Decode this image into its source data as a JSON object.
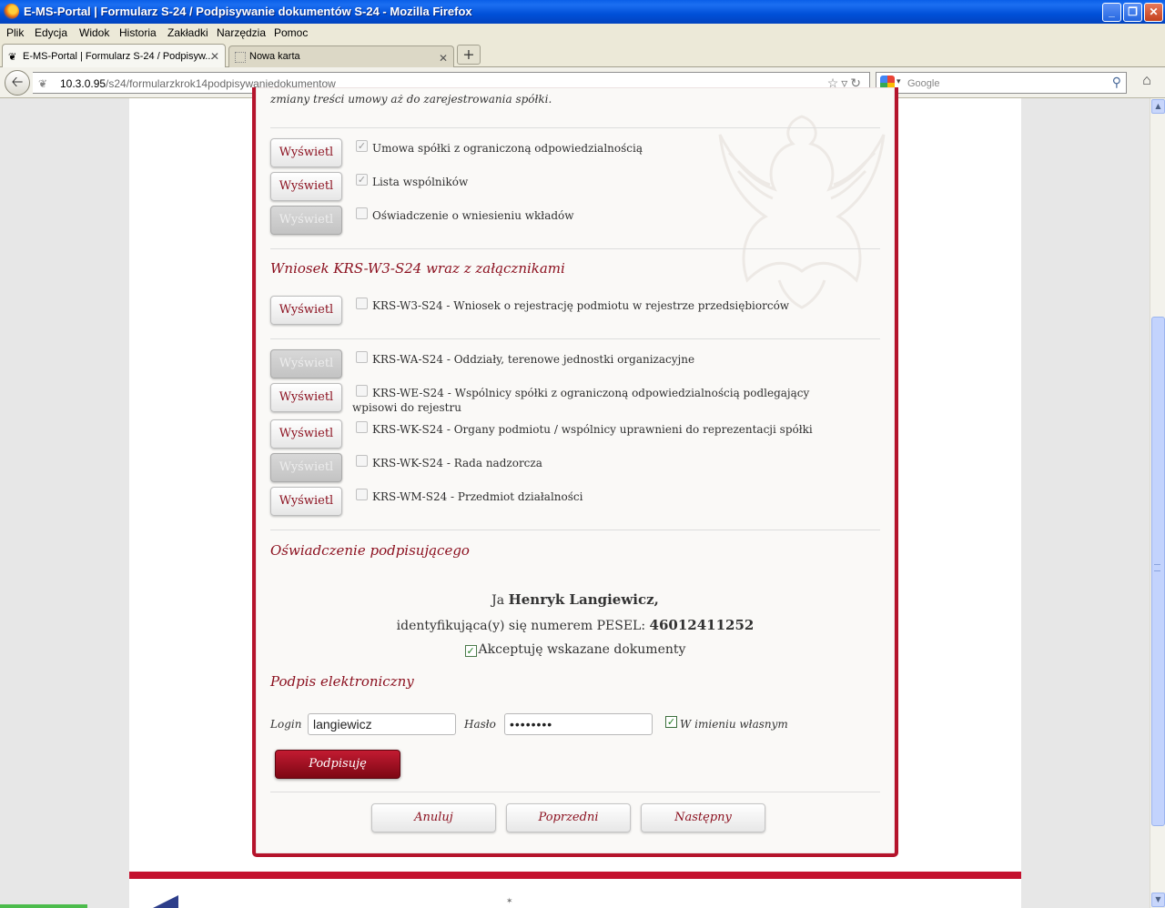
{
  "window": {
    "title": "E-MS-Portal | Formularz S-24 / Podpisywanie dokumentów S-24 - Mozilla Firefox"
  },
  "menu": [
    "Plik",
    "Edycja",
    "Widok",
    "Historia",
    "Zakładki",
    "Narzędzia",
    "Pomoc"
  ],
  "tabs": [
    {
      "label": "E-MS-Portal | Formularz S-24 / Podpisyw..."
    },
    {
      "label": "Nowa karta"
    }
  ],
  "nav": {
    "url_host": "10.3.0.95",
    "url_path": "/s24/formularzkrok14podpisywaniedokumentow",
    "search_placeholder": "Google"
  },
  "intro_text": "zmiany treści umowy aż do zarejestrowania spółki.",
  "group1": [
    {
      "button": "Wyświetl",
      "enabled": true,
      "checked": true,
      "label": "Umowa spółki z ograniczoną odpowiedzialnością"
    },
    {
      "button": "Wyświetl",
      "enabled": true,
      "checked": true,
      "label": "Lista wspólników"
    },
    {
      "button": "Wyświetl",
      "enabled": false,
      "checked": false,
      "label": "Oświadczenie o wniesieniu wkładów"
    }
  ],
  "section_krs_title": "Wniosek KRS-W3-S24 wraz z załącznikami",
  "krs_main": {
    "button": "Wyświetl",
    "enabled": true,
    "checked": false,
    "label": "KRS-W3-S24 - Wniosek o rejestrację podmiotu w rejestrze przedsiębiorców"
  },
  "krs_attachments": [
    {
      "button": "Wyświetl",
      "enabled": false,
      "checked": false,
      "label": "KRS-WA-S24 - Oddziały, terenowe jednostki organizacyjne"
    },
    {
      "button": "Wyświetl",
      "enabled": true,
      "checked": false,
      "label": "KRS-WE-S24 - Wspólnicy spółki z ograniczoną odpowiedzialnością podlegający wpisowi do rejestru"
    },
    {
      "button": "Wyświetl",
      "enabled": true,
      "checked": false,
      "label": "KRS-WK-S24 - Organy podmiotu / wspólnicy uprawnieni do reprezentacji spółki"
    },
    {
      "button": "Wyświetl",
      "enabled": false,
      "checked": false,
      "label": "KRS-WK-S24 - Rada nadzorcza"
    },
    {
      "button": "Wyświetl",
      "enabled": true,
      "checked": false,
      "label": "KRS-WM-S24 - Przedmiot działalności"
    }
  ],
  "declaration": {
    "title": "Oświadczenie podpisującego",
    "prefix": "Ja",
    "name": "Henryk Langiewicz,",
    "pesel_text": "identyfikująca(y) się numerem PESEL:",
    "pesel": "46012411252",
    "accept_label": "Akceptuję wskazane dokumenty",
    "accept_checked": true
  },
  "signature": {
    "title": "Podpis elektroniczny",
    "login_label": "Login",
    "login_value": "langiewicz",
    "password_label": "Hasło",
    "password_value": "••••••••",
    "own_name_label": "W imieniu własnym",
    "own_name_checked": true,
    "sign_button": "Podpisuję"
  },
  "footer_buttons": {
    "cancel": "Anuluj",
    "previous": "Poprzedni",
    "next": "Następny"
  },
  "colors": {
    "brand_red": "#b5142c",
    "xp_blue": "#0050d8"
  }
}
